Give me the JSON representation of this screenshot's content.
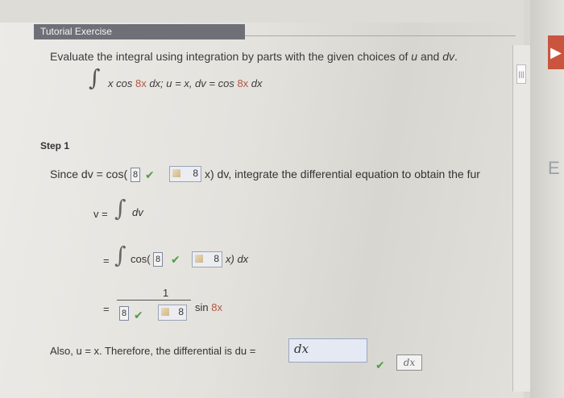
{
  "window": {
    "title": "Tutorial Exercise"
  },
  "prompt": {
    "text": "Evaluate the integral using integration by parts with the given choices of ",
    "u": "u",
    "and": " and ",
    "dv": "dv",
    "end": "."
  },
  "formula": {
    "integral_sign": "∫",
    "integrand_pre": "x cos ",
    "integrand_red": "8x",
    "integrand_post": " dx; u = x, dv = cos ",
    "dv_red": "8x",
    "dv_post": " dx"
  },
  "step": {
    "label": "Step 1"
  },
  "since": {
    "prefix": "Since dv = cos(",
    "box1": "8",
    "box2": "8",
    "suffix": "x) dv, integrate the differential equation to obtain the fur"
  },
  "line_v": {
    "lhs": "v =",
    "integral_sign": "∫",
    "integrand": "dv"
  },
  "line_cos": {
    "eq": "=",
    "integral_sign": "∫",
    "prefix": "cos(",
    "box1": "8",
    "box2": "8",
    "suffix": "x) dx"
  },
  "line_frac": {
    "eq": "=",
    "numerator": "1",
    "den_box1": "8",
    "den_box2": "8",
    "sin_pre": "sin ",
    "sin_red": "8x"
  },
  "also": {
    "text": "Also, u = x. Therefore, the differential is du = ",
    "du_value": "dx",
    "dx_button": "dx"
  },
  "scrollbar": {
    "grip": "|||"
  },
  "right_edge": {
    "letter": "E"
  },
  "colors": {
    "title_bar": "#6f6f78",
    "accent_red": "#b4553f",
    "check_green": "#4f9e46",
    "input_border": "#98a7c4"
  },
  "icons": [
    "check-icon",
    "pencil-icon",
    "scroll-grip-icon"
  ]
}
